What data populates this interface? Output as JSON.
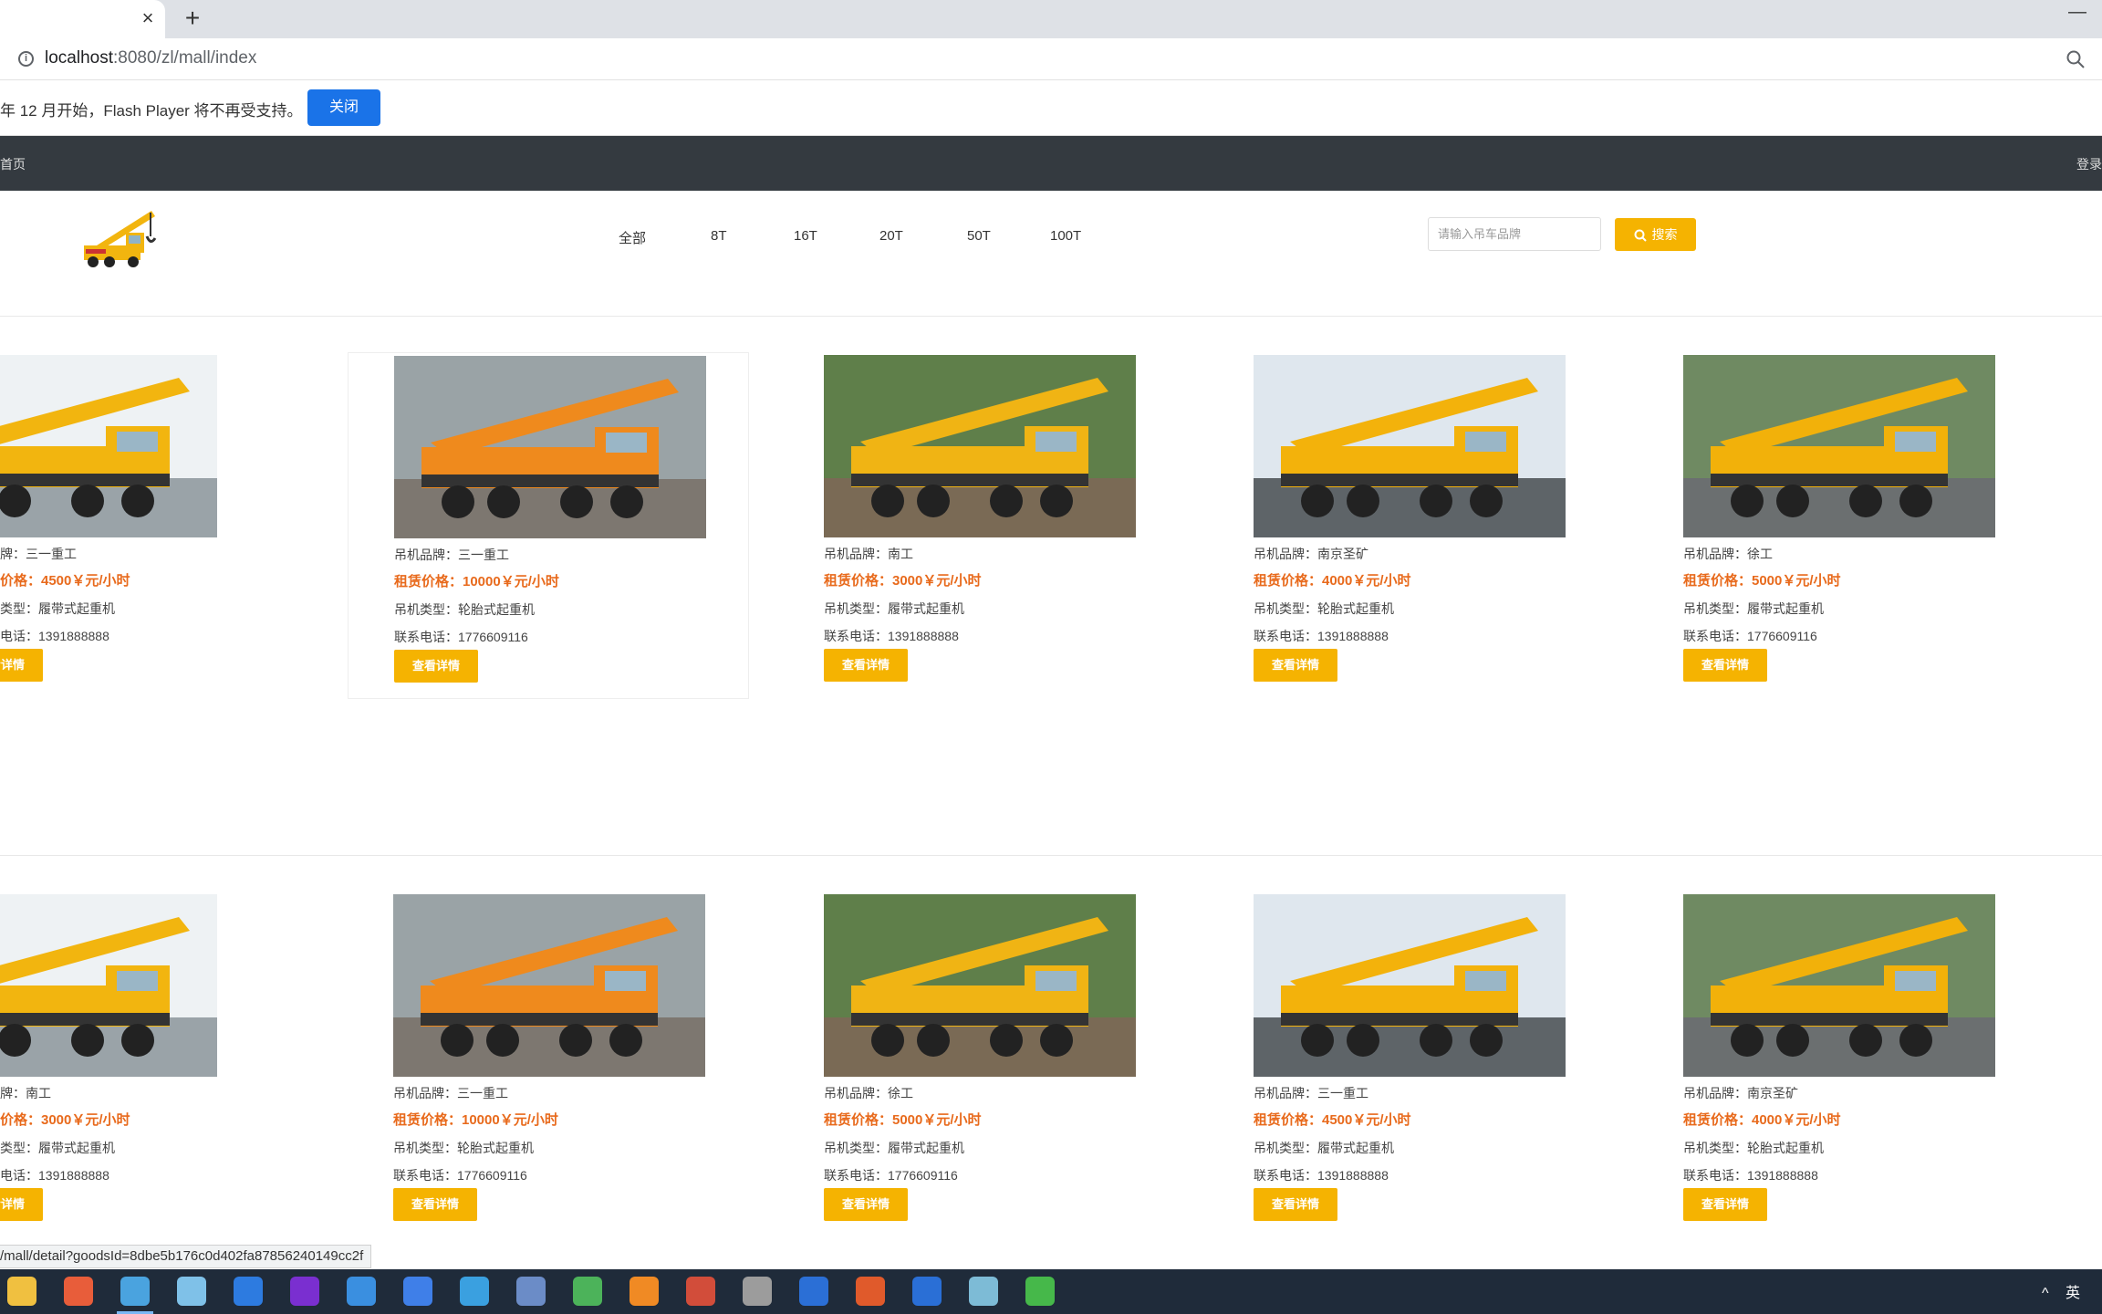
{
  "browser": {
    "tab_close": "×",
    "new_tab": "+",
    "minimize": "—",
    "url_host": "localhost",
    "url_rest": ":8080/zl/mall/index"
  },
  "flash": {
    "message": "年 12 月开始，Flash Player 将不再受支持。",
    "close_label": "关闭"
  },
  "nav": {
    "home": "首页",
    "login": "登录"
  },
  "categories": [
    "全部",
    "8T",
    "16T",
    "20T",
    "50T",
    "100T"
  ],
  "search": {
    "placeholder": "请输入吊车品牌",
    "button_label": "搜索"
  },
  "products": [
    {
      "brand": "牌：三一重工",
      "price": "价格：4500￥元/小时",
      "type": "类型：履带式起重机",
      "phone": "电话：1391888888",
      "button": "查看详情"
    },
    {
      "brand": "吊机品牌：三一重工",
      "price": "租赁价格：10000￥元/小时",
      "type": "吊机类型：轮胎式起重机",
      "phone": "联系电话：1776609116",
      "button": "查看详情"
    },
    {
      "brand": "吊机品牌：南工",
      "price": "租赁价格：3000￥元/小时",
      "type": "吊机类型：履带式起重机",
      "phone": "联系电话：1391888888",
      "button": "查看详情"
    },
    {
      "brand": "吊机品牌：南京圣矿",
      "price": "租赁价格：4000￥元/小时",
      "type": "吊机类型：轮胎式起重机",
      "phone": "联系电话：1391888888",
      "button": "查看详情"
    },
    {
      "brand": "吊机品牌：徐工",
      "price": "租赁价格：5000￥元/小时",
      "type": "吊机类型：履带式起重机",
      "phone": "联系电话：1776609116",
      "button": "查看详情"
    },
    {
      "brand": "牌：南工",
      "price": "价格：3000￥元/小时",
      "type": "类型：履带式起重机",
      "phone": "电话：1391888888",
      "button": "查看详情"
    },
    {
      "brand": "吊机品牌：三一重工",
      "price": "租赁价格：10000￥元/小时",
      "type": "吊机类型：轮胎式起重机",
      "phone": "联系电话：1776609116",
      "button": "查看详情"
    },
    {
      "brand": "吊机品牌：徐工",
      "price": "租赁价格：5000￥元/小时",
      "type": "吊机类型：履带式起重机",
      "phone": "联系电话：1776609116",
      "button": "查看详情"
    },
    {
      "brand": "吊机品牌：三一重工",
      "price": "租赁价格：4500￥元/小时",
      "type": "吊机类型：履带式起重机",
      "phone": "联系电话：1391888888",
      "button": "查看详情"
    },
    {
      "brand": "吊机品牌：南京圣矿",
      "price": "租赁价格：4000￥元/小时",
      "type": "吊机类型：轮胎式起重机",
      "phone": "联系电话：1391888888",
      "button": "查看详情"
    }
  ],
  "status_url": "/mall/detail?goodsId=8dbe5b176c0d402fa87856240149cc2f",
  "tray": {
    "ime": "英"
  },
  "colors": {
    "accent": "#f5b301",
    "price": "#e86a1c",
    "nav": "#343a40",
    "flash_button": "#1a73e8"
  }
}
